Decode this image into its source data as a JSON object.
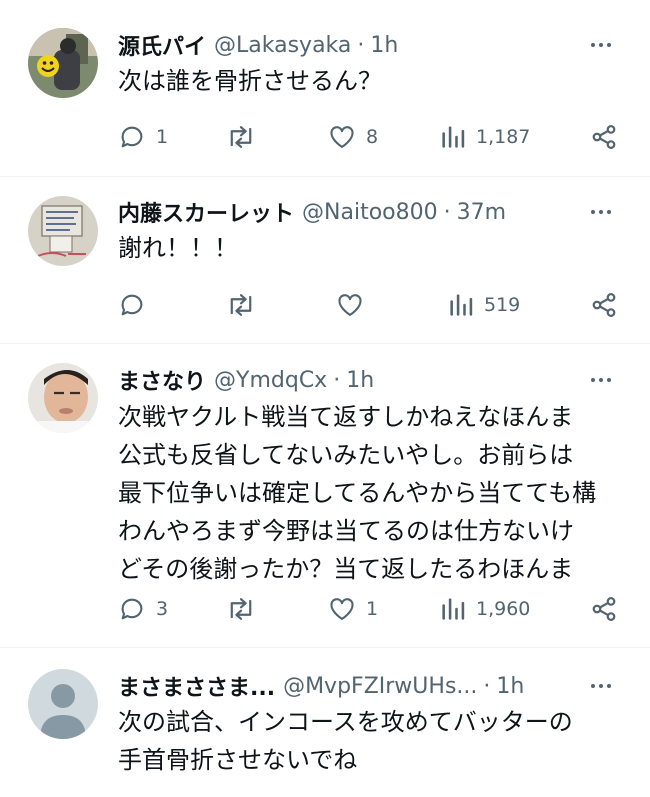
{
  "tweets": [
    {
      "name": "源氏パイ",
      "handle": "@Lakasyaka",
      "time": "1h",
      "text": "次は誰を骨折させるん？",
      "replies": "1",
      "retweets": "",
      "likes": "8",
      "views": "1,187",
      "avatar_icon": "photo-avatar-smiley-icon"
    },
    {
      "name": "内藤スカーレット",
      "handle": "@Naitoo800",
      "time": "37m",
      "text": "謝れ！！！",
      "replies": "",
      "retweets": "",
      "likes": "",
      "views": "519",
      "avatar_icon": "photo-avatar-drawing-icon"
    },
    {
      "name": "まさなり",
      "handle": "@YmdqCx",
      "time": "1h",
      "text": "次戦ヤクルト戦当て返すしかねえなほんま\n公式も反省してないみたいやし。お前らは\n最下位争いは確定してるんやから当てても構\nわんやろまず今野は当てるのは仕方ないけ\nどその後謝ったか？当て返したるわほんま",
      "replies": "3",
      "retweets": "",
      "likes": "1",
      "views": "1,960",
      "avatar_icon": "photo-avatar-person-icon"
    },
    {
      "name": "まさまささま...",
      "handle": "@MvpFZIrwUHs...",
      "time": "1h",
      "text": "次の試合、インコースを攻めてバッターの\n手首骨折させないでね",
      "replies": "",
      "retweets": "",
      "likes": "",
      "views": "",
      "avatar_icon": "default-avatar-icon"
    }
  ],
  "separator": "·",
  "colors": {
    "text": "#0f1419",
    "secondary": "#536471",
    "divider": "#eff3f4",
    "default_avatar_bg": "#cfd9de"
  }
}
